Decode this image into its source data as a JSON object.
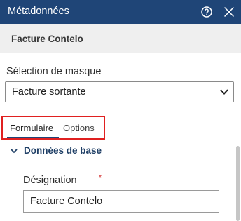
{
  "header": {
    "title": "Métadonnées",
    "help_icon": "help-circle-icon",
    "close_icon": "close-icon"
  },
  "document": {
    "name": "Facture Contelo"
  },
  "mask_selection": {
    "label": "Sélection de masque",
    "value": "Facture sortante"
  },
  "tabs": [
    {
      "label": "Formulaire",
      "active": true
    },
    {
      "label": "Options",
      "active": false
    }
  ],
  "section": {
    "title": "Données de base",
    "expanded": true
  },
  "field": {
    "label": "Désignation",
    "required_marker": "*",
    "value": "Facture Contelo"
  },
  "colors": {
    "header_bg": "#1f4577",
    "highlight": "#e02020",
    "section_title": "#1f3f66"
  }
}
